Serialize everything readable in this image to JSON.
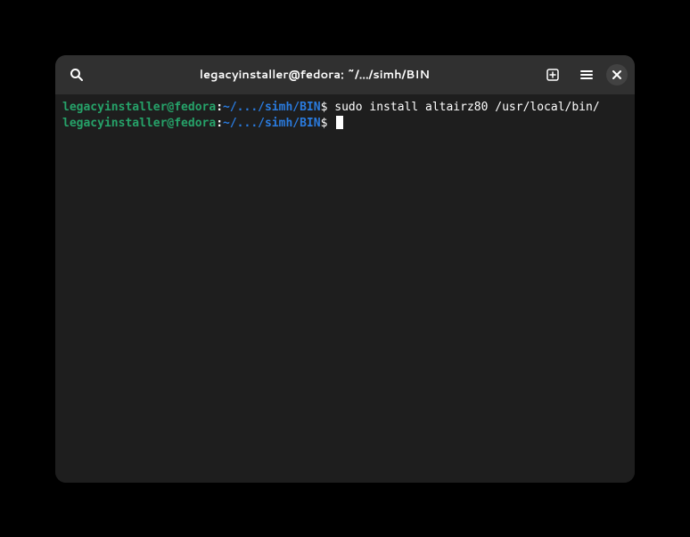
{
  "titlebar": {
    "title": "legacyinstaller@fedora: ~/.../simh/BIN"
  },
  "terminal": {
    "lines": [
      {
        "user": "legacyinstaller@fedora",
        "colon": ":",
        "path": "~/.../simh/BIN",
        "dollar": "$ ",
        "command": "sudo install altairz80 /usr/local/bin/"
      },
      {
        "user": "legacyinstaller@fedora",
        "colon": ":",
        "path": "~/.../simh/BIN",
        "dollar": "$ ",
        "command": ""
      }
    ]
  }
}
